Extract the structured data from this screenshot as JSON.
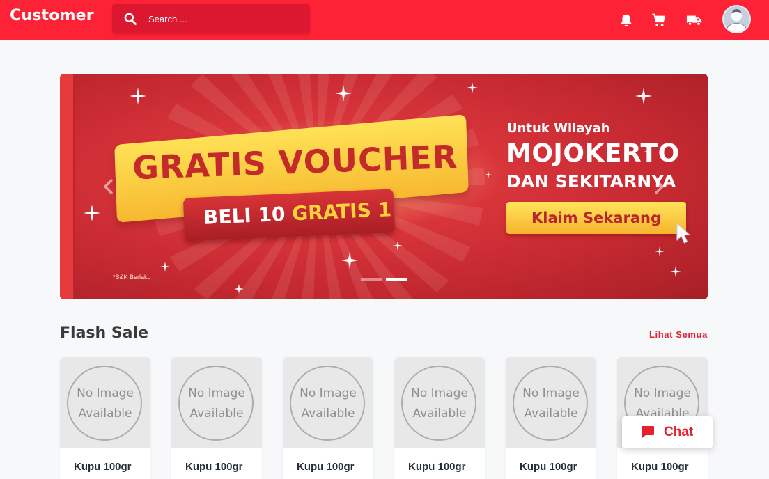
{
  "header": {
    "brand": "Customer",
    "search_placeholder": "Search ...",
    "icons": [
      "search-icon",
      "bell-icon",
      "cart-icon",
      "truck-icon",
      "avatar"
    ]
  },
  "banner": {
    "headline": "GRATIS VOUCHER",
    "sub_prefix": "BELI 10 ",
    "sub_highlight": "GRATIS 1",
    "terms": "*S&K Berlaku",
    "region_intro": "Untuk Wilayah",
    "region_city": "MOJOKERTO",
    "region_area": "DAN SEKITARNYA",
    "cta": "Klaim Sekarang",
    "slides": 2,
    "active_slide": 2
  },
  "flash_sale": {
    "title": "Flash Sale",
    "see_all": "Lihat Semua",
    "products": [
      {
        "placeholder_line1": "No Image",
        "placeholder_line2": "Available",
        "name": "Kupu 100gr"
      },
      {
        "placeholder_line1": "No Image",
        "placeholder_line2": "Available",
        "name": "Kupu 100gr"
      },
      {
        "placeholder_line1": "No Image",
        "placeholder_line2": "Available",
        "name": "Kupu 100gr"
      },
      {
        "placeholder_line1": "No Image",
        "placeholder_line2": "Available",
        "name": "Kupu 100gr"
      },
      {
        "placeholder_line1": "No Image",
        "placeholder_line2": "Available",
        "name": "Kupu 100gr"
      },
      {
        "placeholder_line1": "No Image",
        "placeholder_line2": "Available",
        "name": "Kupu 100gr"
      }
    ]
  },
  "chat": {
    "label": "Chat"
  },
  "colors": {
    "brand_red": "#fd2236",
    "accent_red": "#e4222f",
    "voucher_yellow": "#ffe256"
  }
}
